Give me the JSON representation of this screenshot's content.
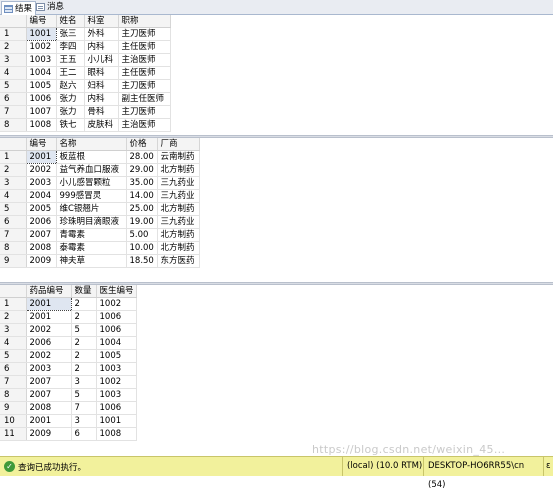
{
  "tabs": [
    {
      "label": "结果",
      "icon": "grid-icon"
    },
    {
      "label": "消息",
      "icon": "messages-icon"
    }
  ],
  "grid1": {
    "columns": [
      "编号",
      "姓名",
      "科室",
      "职称"
    ],
    "rows": [
      [
        "1001",
        "张三",
        "外科",
        "主刀医师"
      ],
      [
        "1002",
        "李四",
        "内科",
        "主任医师"
      ],
      [
        "1003",
        "王五",
        "小儿科",
        "主治医师"
      ],
      [
        "1004",
        "王二",
        "眼科",
        "主任医师"
      ],
      [
        "1005",
        "赵六",
        "妇科",
        "主刀医师"
      ],
      [
        "1006",
        "张力",
        "内科",
        "副主任医师"
      ],
      [
        "1007",
        "张力",
        "骨科",
        "主刀医师"
      ],
      [
        "1008",
        "铁七",
        "皮肤科",
        "主治医师"
      ]
    ]
  },
  "grid2": {
    "columns": [
      "编号",
      "名称",
      "价格",
      "厂商"
    ],
    "rows": [
      [
        "2001",
        "板蓝根",
        "28.00",
        "云南制药"
      ],
      [
        "2002",
        "益气养血口服液",
        "29.00",
        "北方制药"
      ],
      [
        "2003",
        "小儿感冒颗粒",
        "35.00",
        "三九药业"
      ],
      [
        "2004",
        "999感冒灵",
        "14.00",
        "三九药业"
      ],
      [
        "2005",
        "维C银翘片",
        "25.00",
        "北方制药"
      ],
      [
        "2006",
        "珍珠明目滴眼液",
        "19.00",
        "三九药业"
      ],
      [
        "2007",
        "青霉素",
        "5.00",
        "北方制药"
      ],
      [
        "2008",
        "泰霉素",
        "10.00",
        "北方制药"
      ],
      [
        "2009",
        "神夫草",
        "18.50",
        "东方医药"
      ]
    ]
  },
  "grid3": {
    "columns": [
      "药品编号",
      "数量",
      "医生编号"
    ],
    "rows": [
      [
        "2001",
        "2",
        "1002"
      ],
      [
        "2001",
        "2",
        "1006"
      ],
      [
        "2002",
        "5",
        "1006"
      ],
      [
        "2006",
        "2",
        "1004"
      ],
      [
        "2002",
        "2",
        "1005"
      ],
      [
        "2003",
        "2",
        "1003"
      ],
      [
        "2007",
        "3",
        "1002"
      ],
      [
        "2007",
        "5",
        "1003"
      ],
      [
        "2008",
        "7",
        "1006"
      ],
      [
        "2001",
        "3",
        "1001"
      ],
      [
        "2009",
        "6",
        "1008"
      ]
    ]
  },
  "status": {
    "message": "查询已成功执行。",
    "server": "(local) (10.0 RTM)",
    "connection": "DESKTOP-HO6RR55\\cn (54)",
    "overflow": "ε"
  },
  "watermark": "https://blog.csdn.net/weixin_45..."
}
